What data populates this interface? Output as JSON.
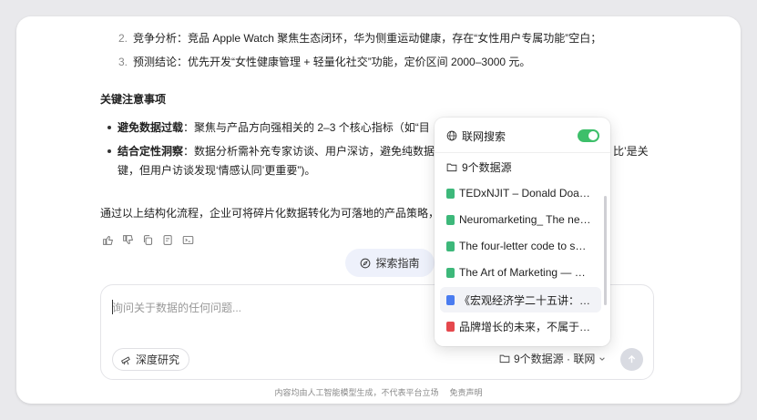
{
  "content": {
    "ordered_list": [
      {
        "num": "2.",
        "text": "竞争分析：竞品 Apple Watch 聚焦生态闭环，华为侧重运动健康，存在“女性用户专属功能”空白；"
      },
      {
        "num": "3.",
        "text": "预测结论：优先开发“女性健康管理 + 轻量化社交”功能，定价区间 2000–3000 元。"
      }
    ],
    "notes_heading": "关键注意事项",
    "bullets": [
      {
        "bold": "避免数据过载",
        "text": "：聚焦与产品方向强相关的 2–3 个核心指标（如“目"
      },
      {
        "bold": "结合定性洞察",
        "text": "：数据分析需补充专家访谈、用户深访，避免纯数据",
        "tail": "比’是关",
        "line2": "键，但用户访谈发现‘情感认同’更重要”)。"
      }
    ],
    "summary": "通过以上结构化流程，企业可将碎片化数据转化为可落地的产品策略，"
  },
  "guide_button": {
    "label": "探索指南"
  },
  "composer": {
    "placeholder": "询问关于数据的任何问题...",
    "deep_research_label": "深度研究",
    "source_selector_label": "9个数据源 · 联网"
  },
  "footer": {
    "disclaimer": "内容均由人工智能模型生成，不代表平台立场",
    "link": "免责声明"
  },
  "popup": {
    "web_search_label": "联网搜索",
    "web_search_enabled": true,
    "sources_header": "9个数据源",
    "sources": [
      {
        "name": "TEDxNJIT – Donald Doa…",
        "type": "web",
        "color": "#3db87a"
      },
      {
        "name": "Neuromarketing_ The ne…",
        "type": "web",
        "color": "#3db87a"
      },
      {
        "name": "The four-letter code to s…",
        "type": "web",
        "color": "#3db87a"
      },
      {
        "name": "The Art of Marketing — …",
        "type": "web",
        "color": "#3db87a"
      },
      {
        "name": "《宏观经济学二十五讲：…",
        "type": "word",
        "color": "#4a7cf0"
      },
      {
        "name": "品牌增长的未来，不属于…",
        "type": "pdf",
        "color": "#e5484d"
      }
    ]
  }
}
